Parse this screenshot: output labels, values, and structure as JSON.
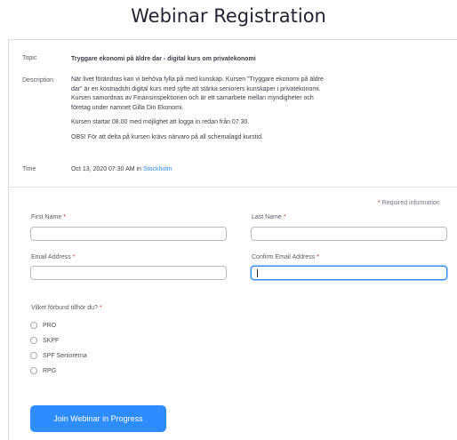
{
  "page": {
    "title": "Webinar Registration"
  },
  "details": {
    "topic_label": "Topic",
    "topic_value": "Tryggare ekonomi på äldre dar - digital kurs om privatekonomi",
    "description_label": "Description",
    "description_paragraphs": [
      "När livet förändras kan vi behöva fylla på med kunskap. Kursen \"Tryggare ekonomi på äldre dar\" är en kostnadsfri digital kurs med syfte att stärka seniorers kunskaper i privatekonomi. Kursen samordnas av Finansinspektionen och är ett samarbete mellan myndigheter och företag under namnet Gilla Din Ekonomi.",
      "Kursen startar 08.00 med möjlighet att logga in redan från 07.30.",
      "OBS! För att delta på kursen krävs närvaro på all schemalagd kurstid."
    ],
    "time_label": "Time",
    "time_value": "Oct 13, 2020 07:30 AM in",
    "time_zone_link": "Stockholm"
  },
  "form": {
    "required_star": "*",
    "required_note": "Required information",
    "first_name_label": "First Name",
    "last_name_label": "Last Name",
    "email_label": "Email Address",
    "confirm_email_label": "Confirm Email Address",
    "first_name_value": "",
    "last_name_value": "",
    "email_value": "",
    "confirm_email_value": "",
    "question_label": "Vilket förbund tillhör du?",
    "options": [
      "PRO",
      "SKPF",
      "SPF Seniorerna",
      "RPG"
    ],
    "submit_label": "Join Webinar in Progress"
  },
  "colors": {
    "accent": "#2d8cff",
    "required": "#e02828"
  }
}
